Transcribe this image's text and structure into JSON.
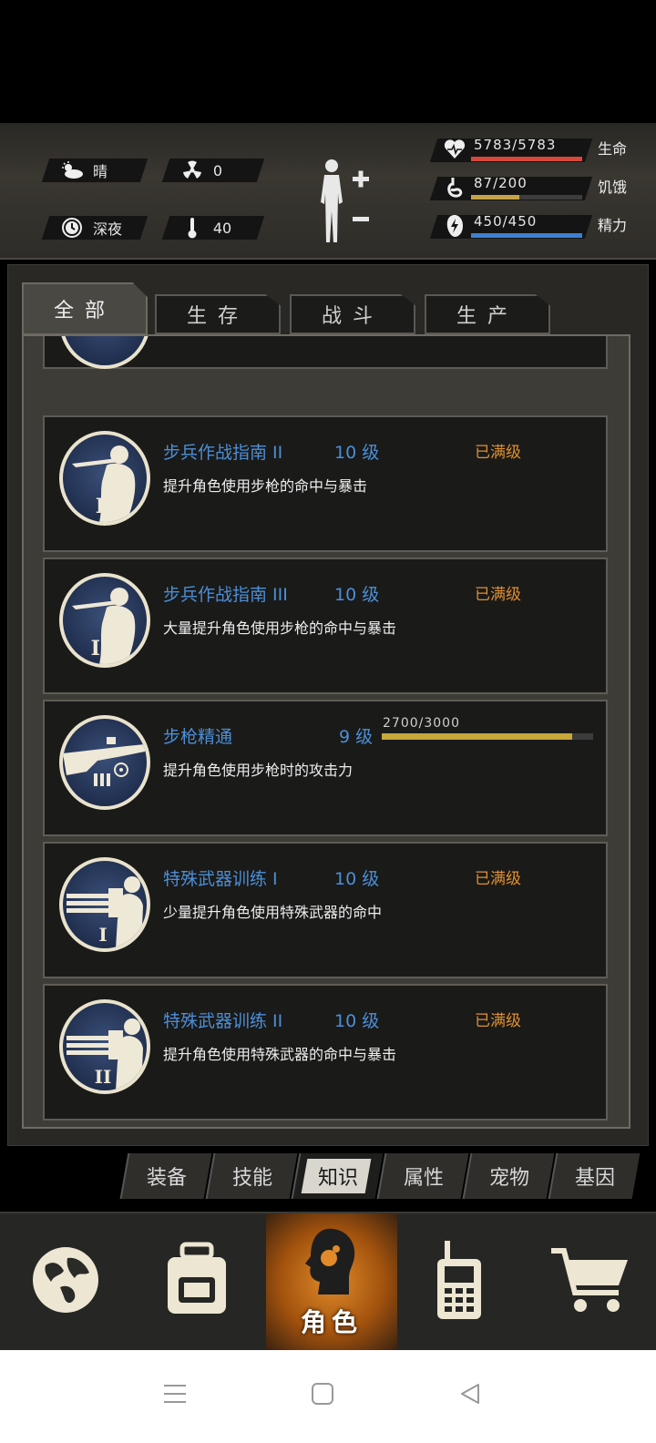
{
  "environment": {
    "weather": "晴",
    "radiation": "0",
    "time_of_day": "深夜",
    "temperature": "40"
  },
  "stats": [
    {
      "icon": "heart-icon",
      "value": "5783/5783",
      "label": "生命",
      "fraction": 1.0,
      "color": "#d6483a"
    },
    {
      "icon": "stomach-icon",
      "value": "87/200",
      "label": "饥饿",
      "fraction": 0.435,
      "color": "#c7a24a"
    },
    {
      "icon": "energy-icon",
      "value": "450/450",
      "label": "精力",
      "fraction": 1.0,
      "color": "#3d7fd1"
    }
  ],
  "category_tabs": [
    "全部",
    "生存",
    "战斗",
    "生产"
  ],
  "active_category": "全部",
  "knowledge_items": [
    {
      "name": "步兵作战指南 II",
      "level": "10 级",
      "status": "已满级",
      "description": "提升角色使用步枪的命中与暴击",
      "icon": "rifleman-icon"
    },
    {
      "name": "步兵作战指南 III",
      "level": "10 级",
      "status": "已满级",
      "description": "大量提升角色使用步枪的命中与暴击",
      "icon": "rifleman-icon"
    },
    {
      "name": "步枪精通",
      "level": "9 级",
      "progress_text": "2700/3000",
      "progress": 0.9,
      "description": "提升角色使用步枪时的攻击力",
      "icon": "rifle-icon"
    },
    {
      "name": "特殊武器训练 I",
      "level": "10 级",
      "status": "已满级",
      "description": "少量提升角色使用特殊武器的命中",
      "icon": "gatling-gunner-icon"
    },
    {
      "name": "特殊武器训练 II",
      "level": "10 级",
      "status": "已满级",
      "description": "提升角色使用特殊武器的命中与暴击",
      "icon": "gatling-gunner-icon"
    }
  ],
  "sub_tabs": [
    "装备",
    "技能",
    "知识",
    "属性",
    "宠物",
    "基因"
  ],
  "active_sub_tab": "知识",
  "nav": {
    "items": [
      "globe-icon",
      "backpack-icon",
      "character-icon",
      "walkie-talkie-icon",
      "cart-icon"
    ],
    "active_label": "角色"
  }
}
